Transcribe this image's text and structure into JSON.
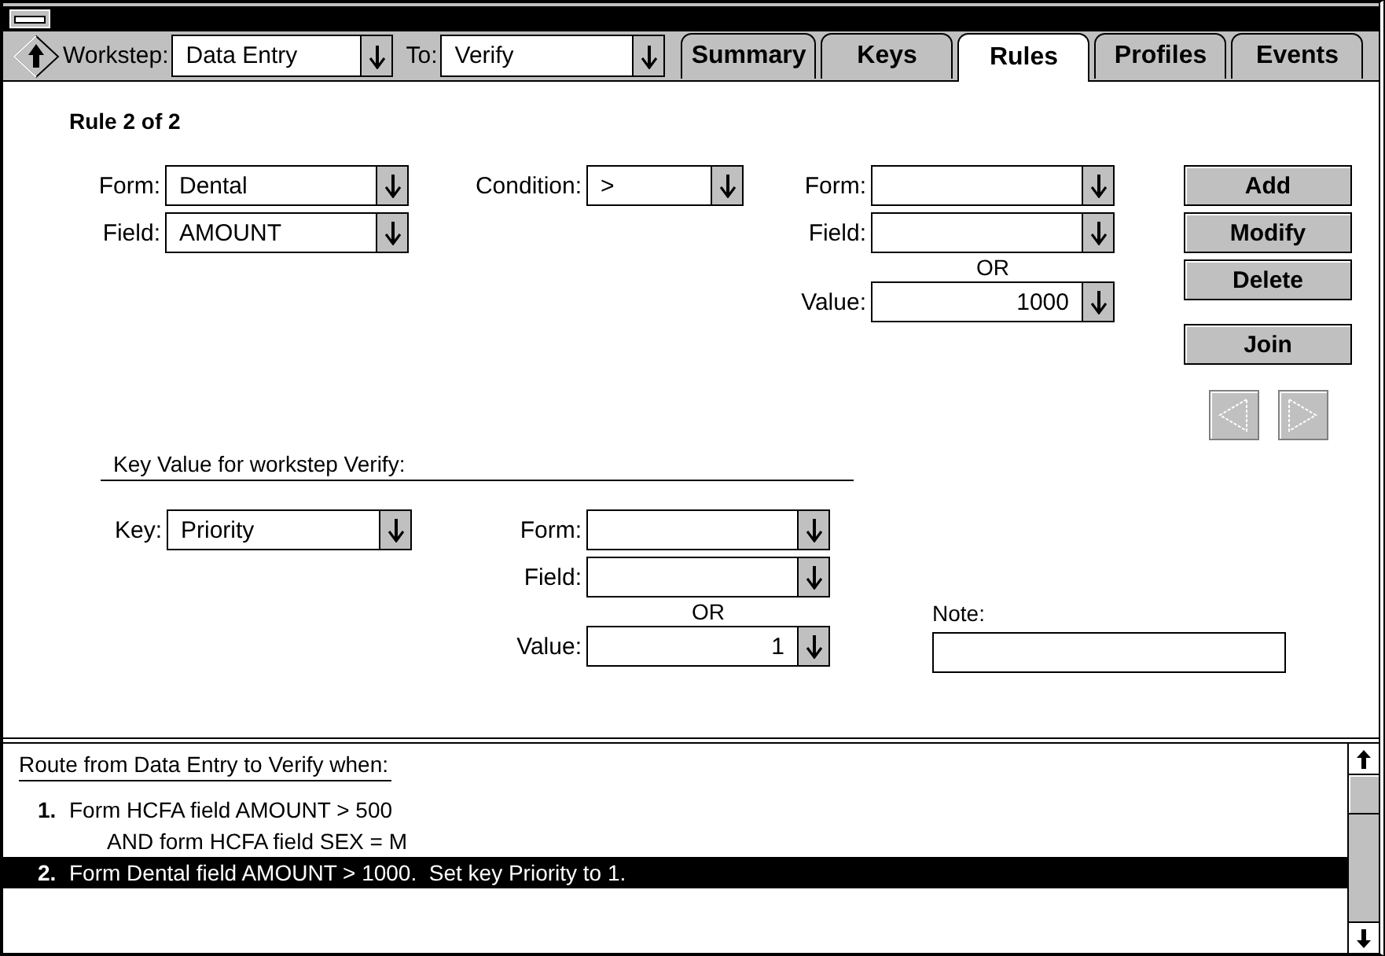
{
  "toolbar": {
    "workstep": {
      "label": "Workstep:",
      "value": "Data Entry"
    },
    "to": {
      "label": "To:",
      "value": "Verify"
    }
  },
  "tabs": [
    {
      "label": "Summary",
      "selected": false
    },
    {
      "label": "Keys",
      "selected": false
    },
    {
      "label": "Rules",
      "selected": true
    },
    {
      "label": "Profiles",
      "selected": false
    },
    {
      "label": "Events",
      "selected": false
    }
  ],
  "rule_counter": "Rule 2 of 2",
  "rule": {
    "left": [
      {
        "label": "Form:",
        "value": "Dental"
      },
      {
        "label": "Field:",
        "value": "AMOUNT"
      }
    ],
    "condition": {
      "label": "Condition:",
      "value": ">"
    },
    "right": [
      {
        "label": "Form:"
      },
      {
        "label": "Field:"
      }
    ],
    "or": "OR",
    "value": {
      "label": "Value:",
      "value": "1000"
    }
  },
  "buttons": [
    {
      "label": "Add"
    },
    {
      "label": "Modify"
    },
    {
      "label": "Delete"
    },
    {
      "label": "Join"
    }
  ],
  "nav_buttons": [
    {
      "kind": "previous",
      "disabled": true
    },
    {
      "kind": "next",
      "disabled": true
    }
  ],
  "key_section": {
    "heading": "Key Value for workstep Verify:",
    "key": {
      "label": "Key:",
      "value": "Priority"
    },
    "fields": [
      {
        "label": "Form:"
      },
      {
        "label": "Field:"
      }
    ],
    "or": "OR",
    "value": {
      "label": "Value:",
      "value": "1"
    },
    "note": {
      "label": "Note:"
    }
  },
  "route_list": {
    "heading": "Route from Data Entry to Verify when:",
    "items": [
      {
        "number": "1.",
        "lines": [
          "Form HCFA field AMOUNT > 500",
          "AND form HCFA field SEX = M"
        ],
        "selected": false
      },
      {
        "number": "2.",
        "lines": [
          "Form Dental field AMOUNT > 1000.  Set key Priority to 1."
        ],
        "selected": true
      }
    ]
  }
}
